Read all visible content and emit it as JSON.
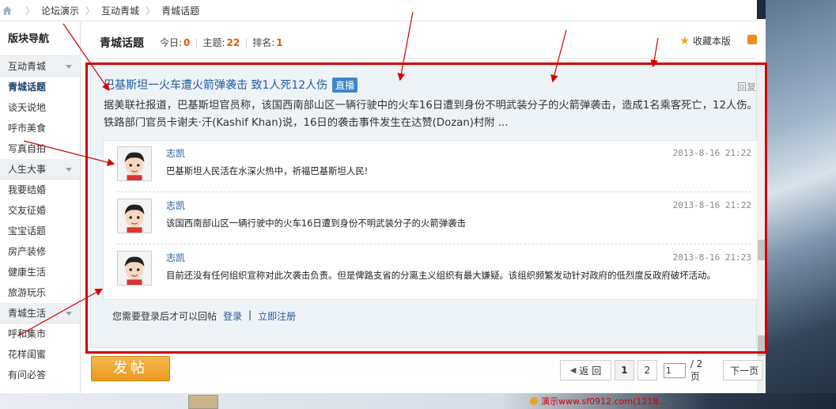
{
  "breadcrumb": {
    "items": [
      "论坛演示",
      "互动青城",
      "青城话题"
    ]
  },
  "sidebar": {
    "title": "版块导航",
    "groups": [
      {
        "label": "互动青城",
        "items": [
          "青城话题",
          "谈天说地",
          "呼市美食",
          "写真自拍"
        ]
      },
      {
        "label": "人生大事",
        "items": [
          "我要结婚",
          "交友征婚",
          "宝宝话题",
          "房产装修",
          "健康生活",
          "旅游玩乐"
        ]
      },
      {
        "label": "青城生活",
        "items": [
          "呼和集市",
          "花样闺蜜",
          "有问必答"
        ]
      }
    ],
    "active": "青城话题"
  },
  "header": {
    "title": "青城话题",
    "today_label": "今日:",
    "today_value": "0",
    "topics_label": "主题:",
    "topics_value": "22",
    "rank_label": "排名:",
    "rank_value": "1",
    "favorite_label": "收藏本版"
  },
  "thread": {
    "title": "巴基斯坦一火车遭火箭弹袭击 致1人死12人伤",
    "badge": "直播",
    "reply_label": "回复",
    "body": "据美联社报道，巴基斯坦官员称，该国西南部山区一辆行驶中的火车16日遭到身份不明武装分子的火箭弹袭击，造成1名乘客死亡，12人伤。铁路部门官员卡谢夫·汗(Kashif Khan)说，16日的袭击事件发生在达赞(Dozan)村附 ...",
    "comments": [
      {
        "user": "志凯",
        "time": "2013-8-16 21:22",
        "text": "巴基斯坦人民活在水深火热中，祈福巴基斯坦人民!"
      },
      {
        "user": "志凯",
        "time": "2013-8-16 21:22",
        "text": "该国西南部山区一辆行驶中的火车16日遭到身份不明武装分子的火箭弹袭击"
      },
      {
        "user": "志凯",
        "time": "2013-8-16 21:23",
        "text": "目前还没有任何组织宣称对此次袭击负责。但是俾路支省的分离主义组织有最大嫌疑。该组织频繁发动针对政府的低烈度反政府破坏活动。"
      }
    ],
    "login_prompt": "您需要登录后才可以回帖",
    "login_link": "登录",
    "register_link": "立即注册"
  },
  "footer": {
    "post_button": "发帖",
    "prev_label": "返 回",
    "pages": [
      "1",
      "2"
    ],
    "current_page": "1",
    "page_input_value": "1",
    "total_label": "/ 2 页",
    "next_label": "下一页"
  },
  "bottom_strip": {
    "text": "演示www.sf0912.com(1218..."
  },
  "colors": {
    "link": "#1f5a9a",
    "accent_orange": "#e99a1c",
    "annotation_red": "#d40000",
    "count_orange": "#e05a00"
  }
}
